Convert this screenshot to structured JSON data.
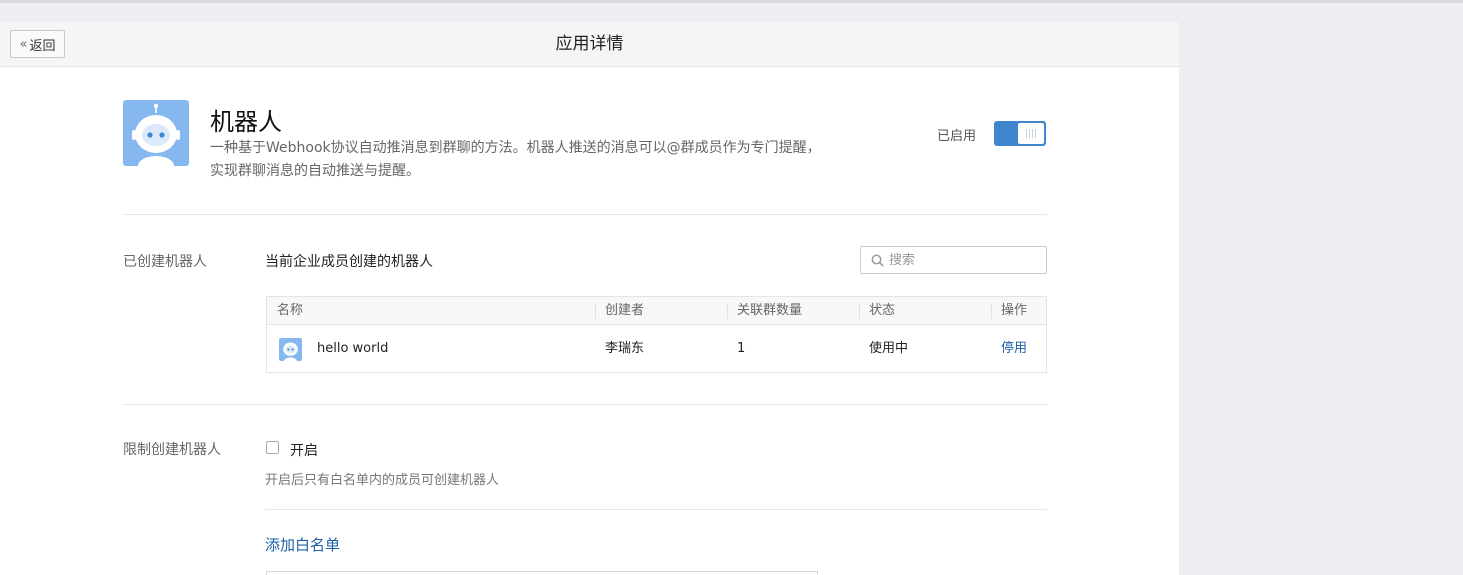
{
  "header": {
    "back_label": "返回",
    "title": "应用详情"
  },
  "app": {
    "name": "机器人",
    "description_line1": "一种基于Webhook协议自动推消息到群聊的方法。机器人推送的消息可以@群成员作为专门提醒，",
    "description_line2": "实现群聊消息的自动推送与提醒。",
    "status_label": "已启用",
    "enabled": true,
    "accent_color": "#3f86cf",
    "icon": "robot-icon"
  },
  "created_section": {
    "label": "已创建机器人",
    "subtitle": "当前企业成员创建的机器人",
    "search_placeholder": "搜索",
    "columns": [
      "名称",
      "创建者",
      "关联群数量",
      "状态",
      "操作"
    ],
    "rows": [
      {
        "name": "hello world",
        "creator": "李瑞东",
        "group_count": "1",
        "status": "使用中",
        "action": "停用"
      }
    ]
  },
  "restrict_section": {
    "label": "限制创建机器人",
    "checkbox_label": "开启",
    "checked": false,
    "hint": "开启后只有白名单内的成员可创建机器人",
    "add_whitelist": "添加白名单"
  }
}
